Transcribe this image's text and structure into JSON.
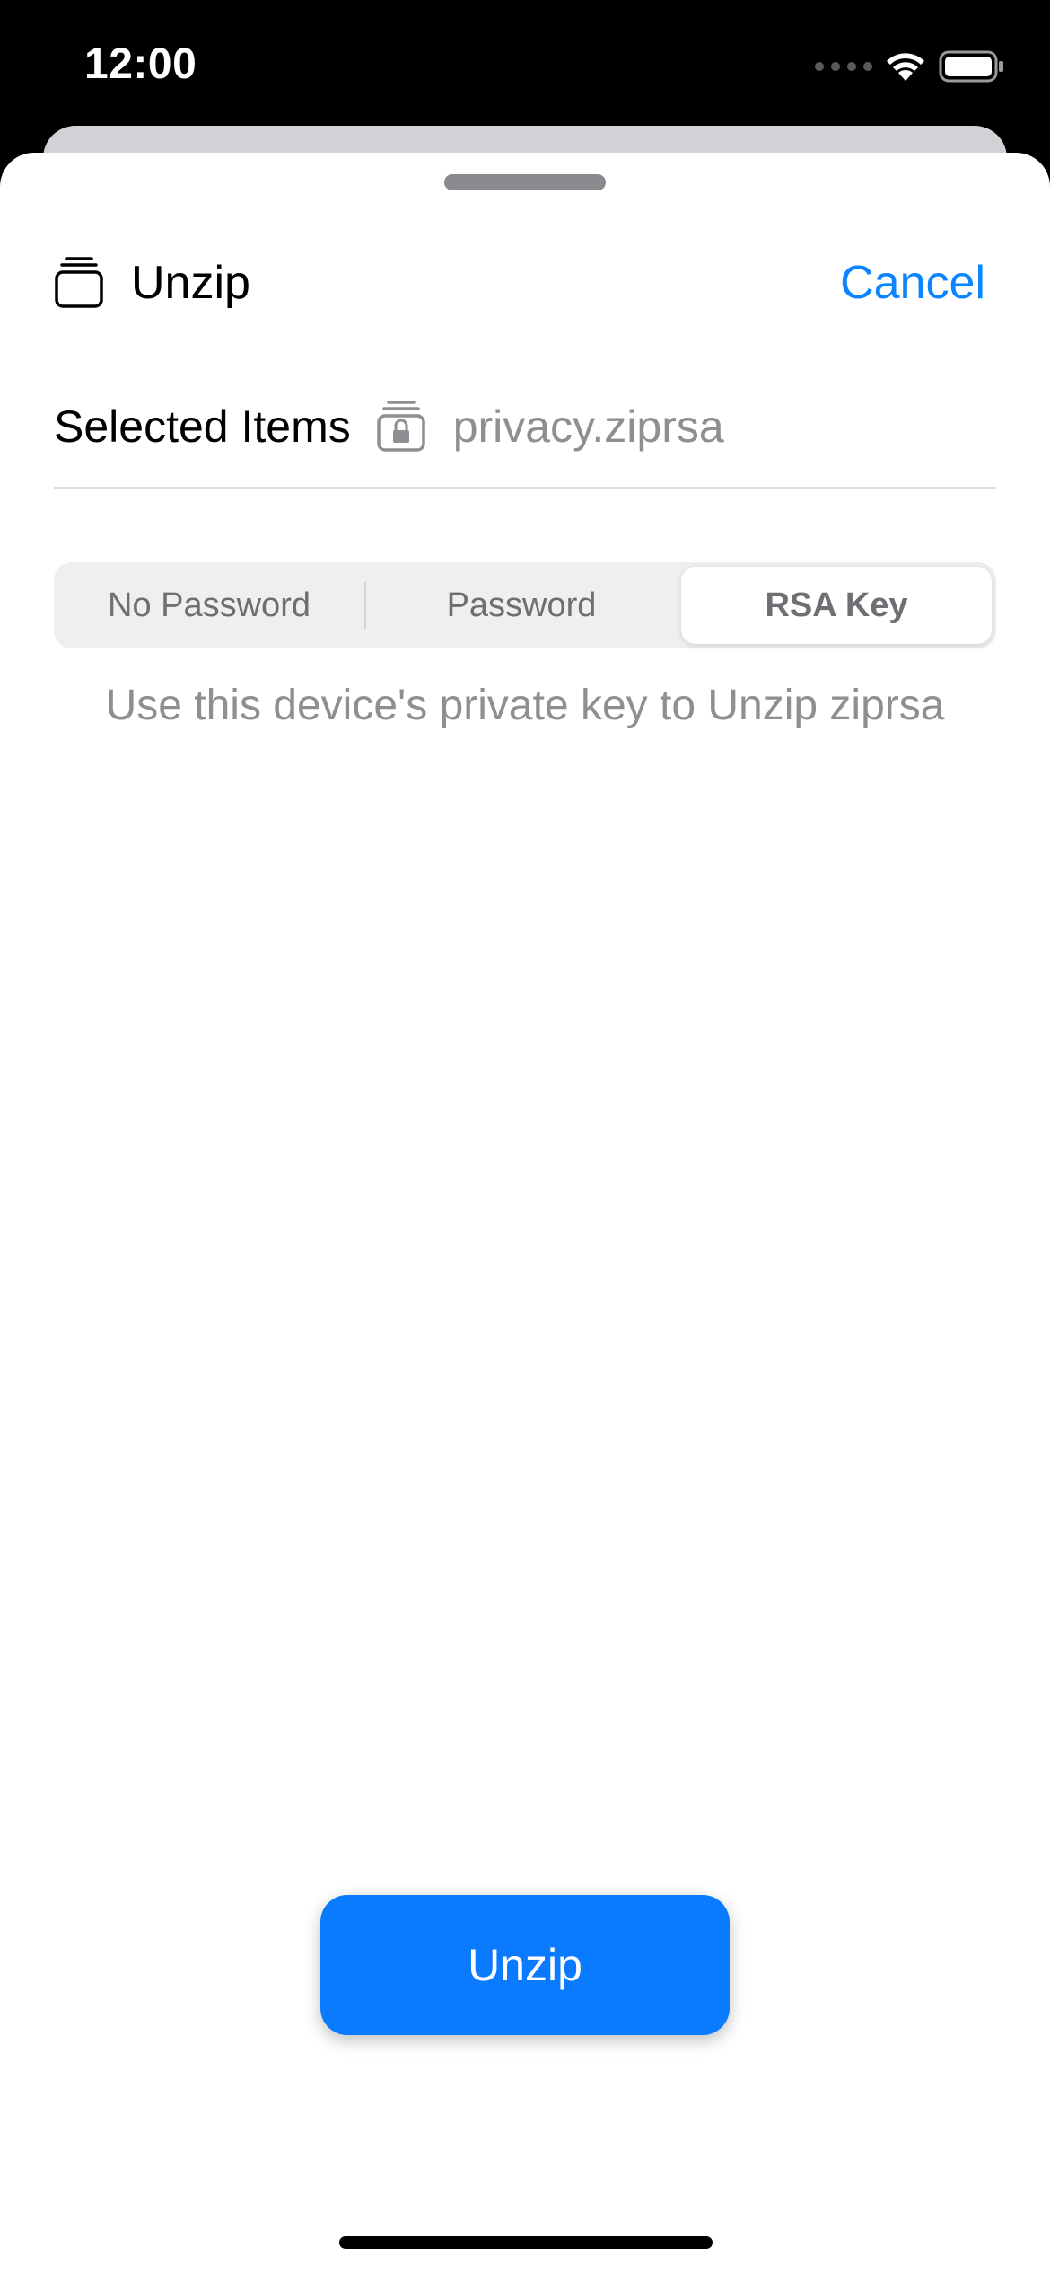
{
  "status_bar": {
    "time": "12:00"
  },
  "header": {
    "icon": "stack-icon",
    "title": "Unzip",
    "cancel_label": "Cancel"
  },
  "selection": {
    "label": "Selected Items",
    "file_icon": "locked-archive-icon",
    "file_name": "privacy.ziprsa"
  },
  "mode_control": {
    "segments": [
      "No Password",
      "Password",
      "RSA Key"
    ],
    "selected": "RSA Key"
  },
  "hint_text": "Use this device's private key to Unzip ziprsa",
  "primary_action": {
    "label": "Unzip"
  },
  "colors": {
    "accent": "#0a84ff",
    "button": "#0a7aff",
    "secondary_text": "#8e8e93",
    "segment_bg": "#efeff0"
  }
}
